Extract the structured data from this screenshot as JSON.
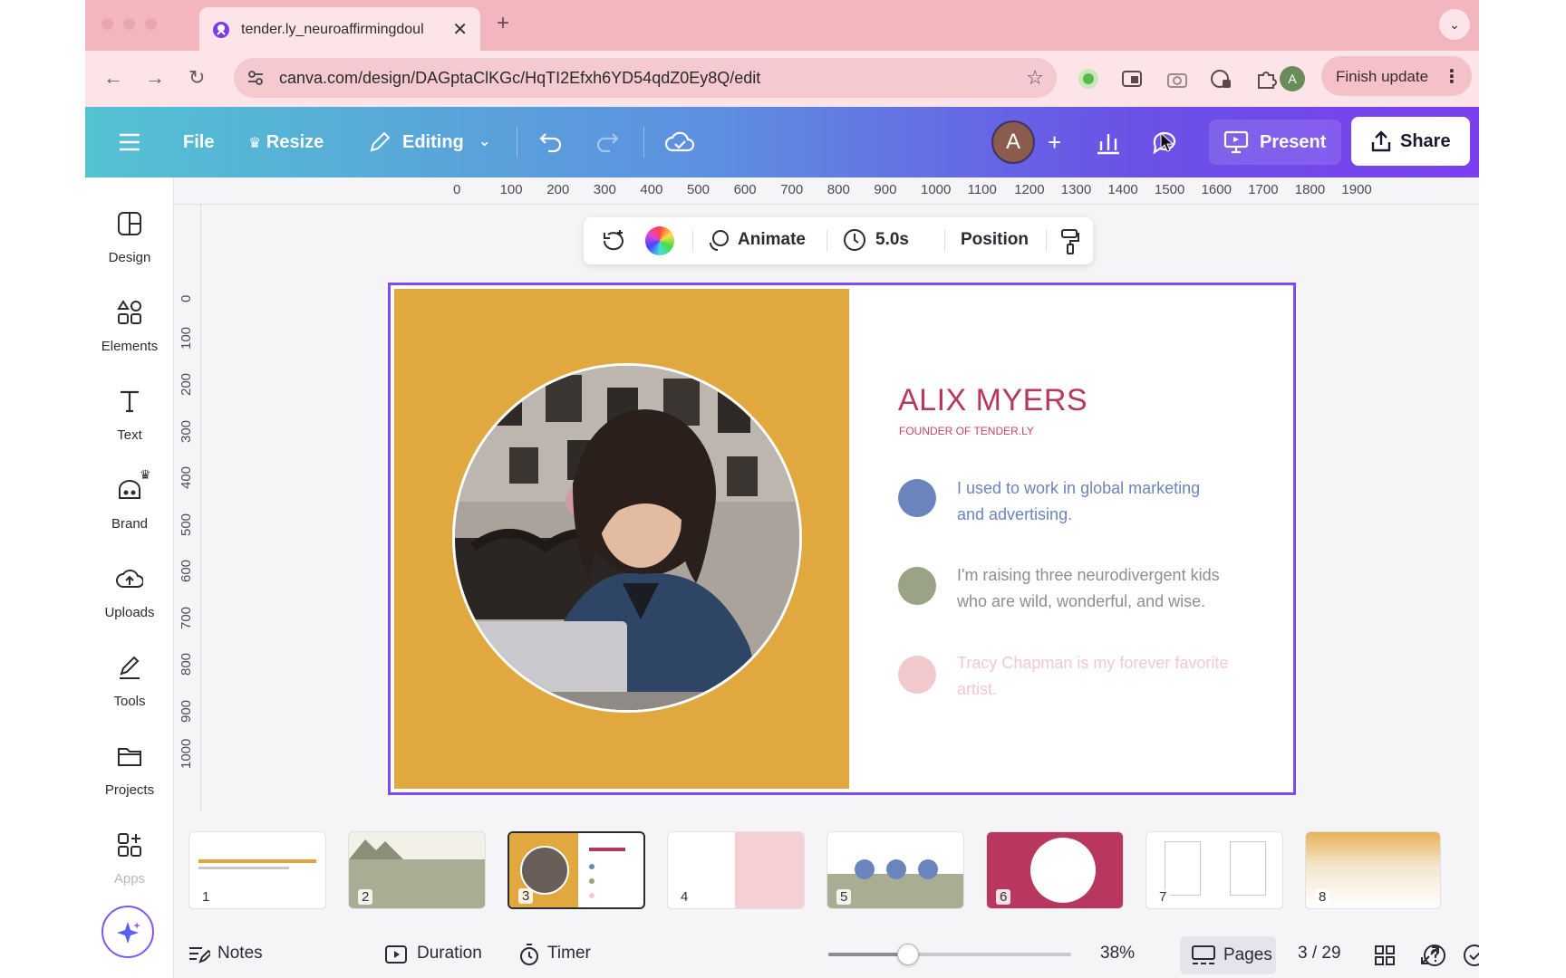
{
  "browser": {
    "tab_title": "tender.ly_neuroaffirmingdoul",
    "url": "canva.com/design/DAGptaClKGc/HqTI2Efxh6YD54qdZ0Ey8Q/edit",
    "profile_initial": "A",
    "finish_update_label": "Finish update"
  },
  "header": {
    "file_label": "File",
    "resize_label": "Resize",
    "editing_label": "Editing",
    "avatar_initial": "A",
    "present_label": "Present",
    "share_label": "Share",
    "gradient_colors": [
      "#53c2d1",
      "#6a52e6",
      "#7b3ff0"
    ]
  },
  "sidebar": {
    "items": [
      {
        "label": "Design",
        "icon": "design-icon"
      },
      {
        "label": "Elements",
        "icon": "elements-icon"
      },
      {
        "label": "Text",
        "icon": "text-icon"
      },
      {
        "label": "Brand",
        "icon": "brand-icon"
      },
      {
        "label": "Uploads",
        "icon": "uploads-icon"
      },
      {
        "label": "Tools",
        "icon": "tools-icon"
      },
      {
        "label": "Projects",
        "icon": "projects-icon"
      },
      {
        "label": "Apps",
        "icon": "apps-icon"
      }
    ]
  },
  "rulers": {
    "horizontal": [
      "0",
      "100",
      "200",
      "300",
      "400",
      "500",
      "600",
      "700",
      "800",
      "900",
      "1000",
      "1100",
      "1200",
      "1300",
      "1400",
      "1500",
      "1600",
      "1700",
      "1800",
      "1900"
    ],
    "vertical": [
      "0",
      "100",
      "200",
      "300",
      "400",
      "500",
      "600",
      "700",
      "800",
      "900",
      "1000"
    ]
  },
  "context_toolbar": {
    "animate_label": "Animate",
    "duration_label": "5.0s",
    "position_label": "Position"
  },
  "slide": {
    "name": "ALIX MYERS",
    "subtitle": "FOUNDER OF TENDER.LY",
    "left_panel_color": "#e0a83e",
    "bullets": [
      {
        "text": "I used to work in global marketing and advertising.",
        "dot_color": "#6b84be",
        "text_color": "#6b84be"
      },
      {
        "text": "I'm raising three neurodivergent kids who are wild, wonderful, and wise.",
        "dot_color": "#9aa386",
        "text_color": "#8e8e8e"
      },
      {
        "text": "Tracy Chapman is my forever favorite artist.",
        "dot_color": "#f2c9cd",
        "text_color": "#f2c9cd"
      }
    ]
  },
  "thumbnails": [
    "1",
    "2",
    "3",
    "4",
    "5",
    "6",
    "7",
    "8"
  ],
  "bottom_bar": {
    "notes_label": "Notes",
    "duration_label": "Duration",
    "timer_label": "Timer",
    "zoom": "38%",
    "zoom_fraction": 0.33,
    "pages_label": "Pages",
    "page_counter": "3 / 29"
  }
}
